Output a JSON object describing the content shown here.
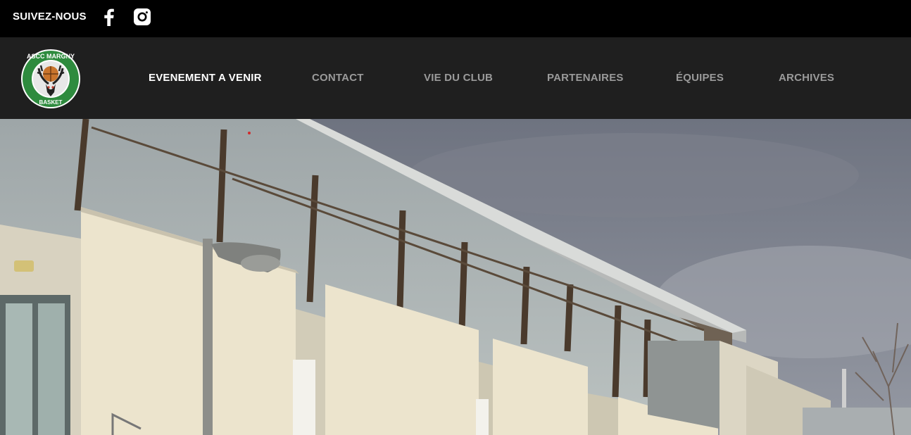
{
  "topbar": {
    "follow_label": "SUIVEZ-NOUS",
    "icons": [
      "facebook-icon",
      "instagram-icon"
    ]
  },
  "logo": {
    "text_top": "ASCC MARGNY",
    "text_bottom": "BASKET",
    "accent": "#2e8b3e"
  },
  "nav": {
    "items": [
      {
        "label": "EVENEMENT A VENIR",
        "active": true
      },
      {
        "label": "CONTACT",
        "active": false
      },
      {
        "label": "VIE DU CLUB",
        "active": false
      },
      {
        "label": "PARTENAIRES",
        "active": false
      },
      {
        "label": "ÉQUIPES",
        "active": false
      },
      {
        "label": "ARCHIVES",
        "active": false
      }
    ]
  },
  "colors": {
    "topbar_bg": "#000000",
    "navbar_bg": "#1f1f1f",
    "nav_active": "#ffffff",
    "nav_inactive": "#9a9a9a"
  }
}
